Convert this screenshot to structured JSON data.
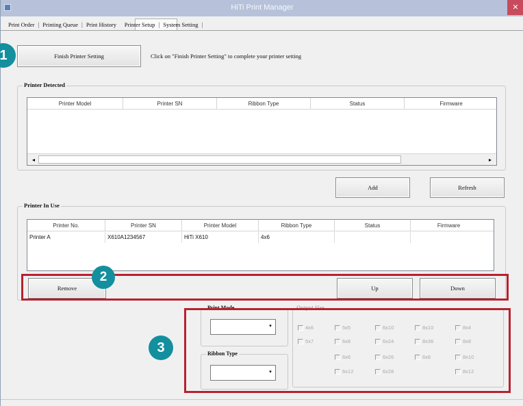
{
  "window": {
    "title": "HiTi Print Manager",
    "close_glyph": "✕"
  },
  "tabs": [
    "Print Order",
    "Printing Queue",
    "Print History",
    "Printer Setup",
    "System Setting"
  ],
  "active_tab": "Printer Setup",
  "setup": {
    "finish_button": "Finish Printer Setting",
    "hint": "Click on \"Finish Printer Setting\" to complete your printer setting"
  },
  "printer_detected": {
    "legend": "Printer Detected",
    "columns": [
      "Printer Model",
      "Printer SN",
      "Ribbon Type",
      "Status",
      "Firmware"
    ],
    "rows": [],
    "scroll_left": "◂",
    "scroll_right": "▸"
  },
  "detected_actions": {
    "add": "Add",
    "refresh": "Refresh"
  },
  "printer_in_use": {
    "legend": "Printer In Use",
    "columns": [
      "Printer No.",
      "Printer SN",
      "Printer Model",
      "Ribbon Type",
      "Status",
      "Firmware"
    ],
    "rows": [
      {
        "printer_no": "Printer A",
        "printer_sn": "X610A1234567",
        "printer_model": "HiTi X610",
        "ribbon_type": "4x6",
        "status": "",
        "firmware": ""
      }
    ]
  },
  "in_use_actions": {
    "remove": "Remove",
    "up": "Up",
    "down": "Down"
  },
  "options": {
    "print_mode_label": "Print Mode",
    "ribbon_type_label": "Ribbon Type",
    "output_size_label": "Output Size",
    "dropdown_glyph": "▾",
    "sizes": [
      [
        "4x6",
        "5x5",
        "6x10",
        "8x10",
        "8x4"
      ],
      [
        "5x7",
        "6x8",
        "6x24",
        "8x36",
        "8x8"
      ],
      [
        "",
        "6x6",
        "6x26",
        "6x8",
        "8x10"
      ],
      [
        "",
        "6x12",
        "6x28",
        "",
        "8x12"
      ]
    ]
  },
  "markers": [
    "1",
    "2",
    "3"
  ],
  "colors": {
    "marker": "#138f9e",
    "highlight": "#b8202f",
    "titlebar": "#b7c2da",
    "close": "#c74b5c"
  }
}
